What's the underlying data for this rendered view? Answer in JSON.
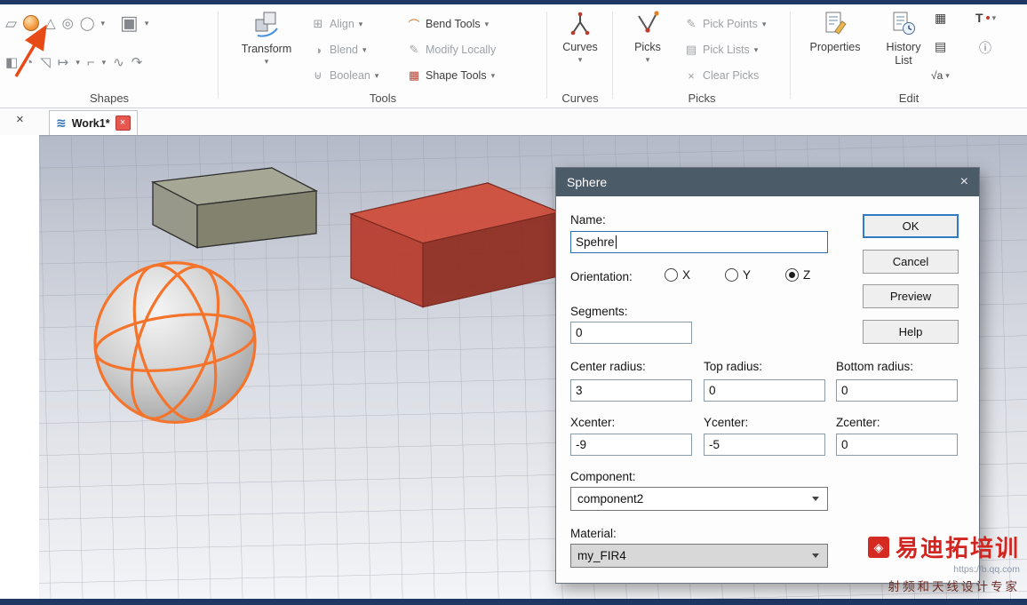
{
  "ribbon": {
    "shapes": {
      "label": "Shapes"
    },
    "tools": {
      "label": "Tools",
      "transform": "Transform",
      "align": "Align",
      "blend": "Blend",
      "boolean": "Boolean",
      "bend_tools": "Bend Tools",
      "modify_locally": "Modify Locally",
      "shape_tools": "Shape Tools"
    },
    "curves": {
      "label": "Curves",
      "button": "Curves"
    },
    "picks": {
      "label": "Picks",
      "button": "Picks",
      "pick_points": "Pick Points",
      "pick_lists": "Pick Lists",
      "clear_picks": "Clear Picks"
    },
    "edit": {
      "label": "Edit",
      "properties": "Properties",
      "history_list": "History List",
      "sqrt": "√a"
    }
  },
  "tabbar": {
    "tab": "Work1*"
  },
  "dialog": {
    "title": "Sphere",
    "name_label": "Name:",
    "name_value": "Spehre",
    "orientation_label": "Orientation:",
    "orientation_options": [
      "X",
      "Y",
      "Z"
    ],
    "orientation_selected": "Z",
    "segments_label": "Segments:",
    "segments_value": "0",
    "center_radius_label": "Center radius:",
    "center_radius_value": "3",
    "top_radius_label": "Top radius:",
    "top_radius_value": "0",
    "bottom_radius_label": "Bottom radius:",
    "bottom_radius_value": "0",
    "xcenter_label": "Xcenter:",
    "xcenter_value": "-9",
    "ycenter_label": "Ycenter:",
    "ycenter_value": "-5",
    "zcenter_label": "Zcenter:",
    "zcenter_value": "0",
    "component_label": "Component:",
    "component_value": "component2",
    "material_label": "Material:",
    "material_value": "my_FIR4",
    "ok": "OK",
    "cancel": "Cancel",
    "preview": "Preview",
    "help": "Help"
  },
  "watermark": {
    "brand": "易迪拓培训",
    "tagline": "射频和天线设计专家",
    "url": "https://b.qq.com"
  },
  "icons": {
    "dropdown": "▾",
    "close_x": "×",
    "box": "▱",
    "cone": "△",
    "torus": "◎",
    "cylinder": "◯",
    "extrude": "▣",
    "sketch": "◧",
    "face": "◔",
    "chamfer": "◹",
    "extrude_face": "↦",
    "offset": "⌐",
    "curve_wave": "∿",
    "arc": "↷",
    "align": "⊞",
    "blend": "◑",
    "boolean": "⊎",
    "bend": "⌒",
    "modify": "✎",
    "shape_tools": "▦",
    "pick_points": "✎",
    "pick_lists": "▤",
    "clear_picks": "×",
    "calculator": "▦",
    "document": "▤",
    "t_tool": "T",
    "info": "ⓘ",
    "wave": "≋"
  },
  "colors": {
    "dialog_titlebar": "#4c5b68",
    "wireframe_orange": "#f5742c",
    "default_button_border": "#2f7cc4",
    "watermark_red": "#d22520",
    "chrome_navy": "#1e3763"
  }
}
